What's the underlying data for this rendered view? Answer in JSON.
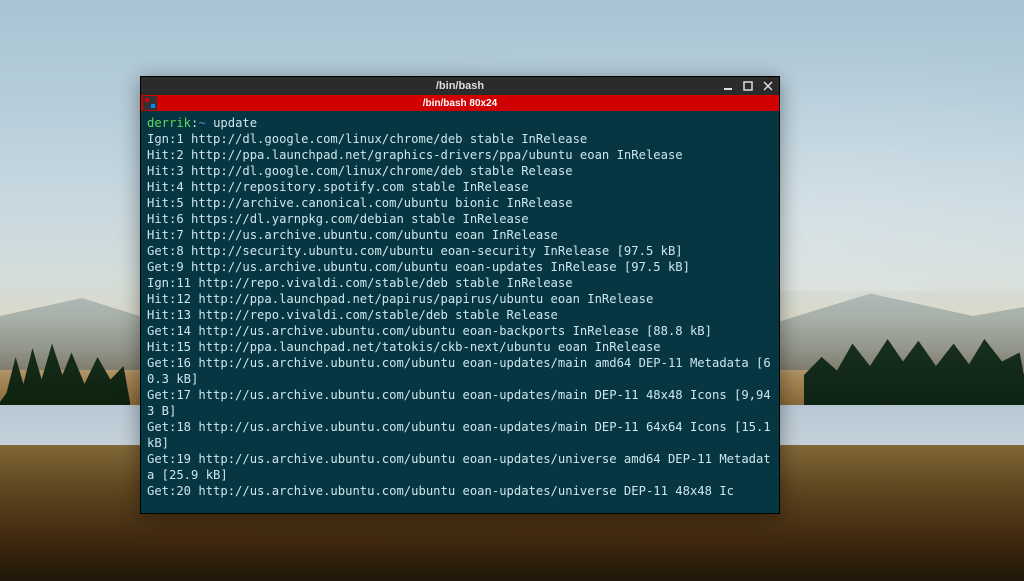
{
  "window": {
    "outer_title": "/bin/bash",
    "inner_title": "/bin/bash 80x24"
  },
  "prompt": {
    "user_host": "derrik",
    "separator": ":",
    "path": "~",
    "symbol": " ",
    "command": "update"
  },
  "lines": [
    "Ign:1 http://dl.google.com/linux/chrome/deb stable InRelease",
    "Hit:2 http://ppa.launchpad.net/graphics-drivers/ppa/ubuntu eoan InRelease",
    "Hit:3 http://dl.google.com/linux/chrome/deb stable Release",
    "Hit:4 http://repository.spotify.com stable InRelease",
    "Hit:5 http://archive.canonical.com/ubuntu bionic InRelease",
    "Hit:6 https://dl.yarnpkg.com/debian stable InRelease",
    "Hit:7 http://us.archive.ubuntu.com/ubuntu eoan InRelease",
    "Get:8 http://security.ubuntu.com/ubuntu eoan-security InRelease [97.5 kB]",
    "Get:9 http://us.archive.ubuntu.com/ubuntu eoan-updates InRelease [97.5 kB]",
    "Ign:11 http://repo.vivaldi.com/stable/deb stable InRelease",
    "Hit:12 http://ppa.launchpad.net/papirus/papirus/ubuntu eoan InRelease",
    "Hit:13 http://repo.vivaldi.com/stable/deb stable Release",
    "Get:14 http://us.archive.ubuntu.com/ubuntu eoan-backports InRelease [88.8 kB]",
    "Hit:15 http://ppa.launchpad.net/tatokis/ckb-next/ubuntu eoan InRelease",
    "Get:16 http://us.archive.ubuntu.com/ubuntu eoan-updates/main amd64 DEP-11 Metadata [60.3 kB]",
    "Get:17 http://us.archive.ubuntu.com/ubuntu eoan-updates/main DEP-11 48x48 Icons [9,943 B]",
    "Get:18 http://us.archive.ubuntu.com/ubuntu eoan-updates/main DEP-11 64x64 Icons [15.1 kB]",
    "Get:19 http://us.archive.ubuntu.com/ubuntu eoan-updates/universe amd64 DEP-11 Metadata [25.9 kB]",
    "Get:20 http://us.archive.ubuntu.com/ubuntu eoan-updates/universe DEP-11 48x48 Ic"
  ]
}
